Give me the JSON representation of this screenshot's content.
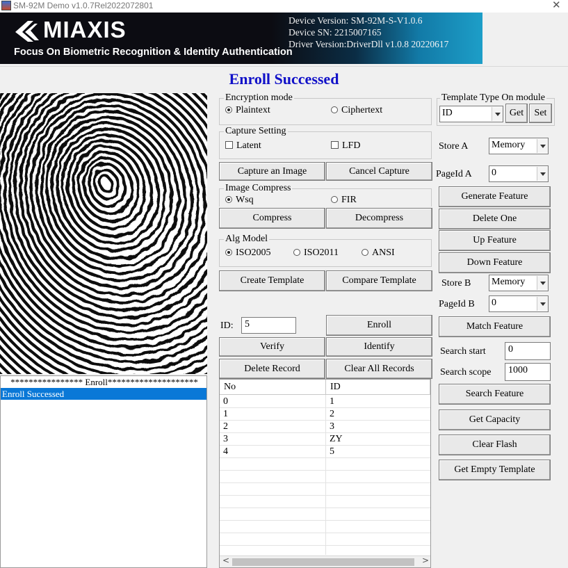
{
  "window": {
    "title": "SM-92M Demo v1.0.7Rel2022072801",
    "close_glyph": "✕"
  },
  "banner": {
    "brand": "MIAXIS",
    "slogan": "Focus On Biometric Recognition & Identity Authentication",
    "device_version": "Device Version: SM-92M-S-V1.0.6",
    "device_sn": "Device SN: 2215007165",
    "driver": "Driver Version:DriverDll v1.0.8 20220617"
  },
  "status": {
    "text": "Enroll Successed",
    "color": "#1010c8"
  },
  "log": {
    "lines": [
      "**************** Enroll********************",
      "Enroll Successed"
    ],
    "selected_index": 1,
    "selected_color": "#0a78d7"
  },
  "encryption": {
    "legend": "Encryption mode",
    "options": [
      "Plaintext",
      "Ciphertext"
    ],
    "selected": "Plaintext"
  },
  "capture_setting": {
    "legend": "Capture Setting",
    "options": [
      "Latent",
      "LFD"
    ]
  },
  "capture_buttons": {
    "capture": "Capture an Image",
    "cancel": "Cancel Capture"
  },
  "image_compress": {
    "legend": "Image Compress",
    "options": [
      "Wsq",
      "FIR"
    ],
    "selected": "Wsq",
    "compress": "Compress",
    "decompress": "Decompress"
  },
  "alg_model": {
    "legend": "Alg Model",
    "options": [
      "ISO2005",
      "ISO2011",
      "ANSI"
    ],
    "selected": "ISO2005"
  },
  "template_buttons": {
    "create": "Create Template",
    "compare": "Compare Template"
  },
  "enroll": {
    "id_label": "ID:",
    "id_value": "5",
    "enroll": "Enroll",
    "verify": "Verify",
    "identify": "Identify",
    "delete_record": "Delete Record",
    "clear_all": "Clear All Records"
  },
  "table": {
    "columns": [
      "No",
      "ID"
    ],
    "rows": [
      [
        "0",
        "1"
      ],
      [
        "1",
        "2"
      ],
      [
        "2",
        "3"
      ],
      [
        "3",
        "ZY"
      ],
      [
        "4",
        "5"
      ]
    ],
    "scroll_left": "<",
    "scroll_right": ">"
  },
  "module": {
    "legend": "Template Type On module",
    "type_value": "ID",
    "get": "Get",
    "set": "Set",
    "store_a_label": "Store A",
    "store_a_value": "Memory",
    "page_a_label": "PageId A",
    "page_a_value": "0",
    "generate": "Generate Feature",
    "delete_one": "Delete One",
    "up": "Up Feature",
    "down": "Down Feature",
    "store_b_label": "Store B",
    "store_b_value": "Memory",
    "page_b_label": "PageId B",
    "page_b_value": "0",
    "match": "Match Feature",
    "search_start_label": "Search start",
    "search_start_value": "0",
    "search_scope_label": "Search scope",
    "search_scope_value": "1000",
    "search": "Search Feature",
    "capacity": "Get Capacity",
    "clear_flash": "Clear Flash",
    "empty_template": "Get Empty Template"
  }
}
